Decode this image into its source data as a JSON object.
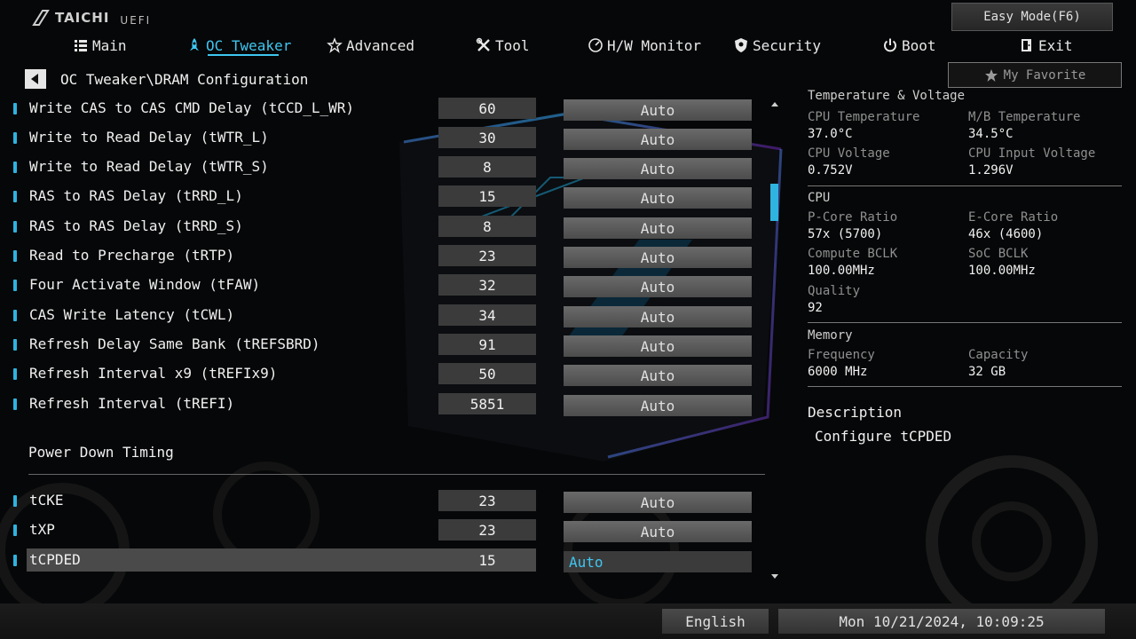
{
  "app": {
    "brand": "TAICHI",
    "subtitle": "UEFI"
  },
  "header": {
    "easy_mode_label": "Easy Mode(F6)"
  },
  "nav": [
    {
      "label": "Main",
      "icon": "list-icon",
      "active": false
    },
    {
      "label": "OC Tweaker",
      "icon": "rocket-icon",
      "active": true
    },
    {
      "label": "Advanced",
      "icon": "star-icon",
      "active": false
    },
    {
      "label": "Tool",
      "icon": "tools-icon",
      "active": false
    },
    {
      "label": "H/W Monitor",
      "icon": "monitor-icon",
      "active": false
    },
    {
      "label": "Security",
      "icon": "shield-icon",
      "active": false
    },
    {
      "label": "Boot",
      "icon": "power-icon",
      "active": false
    },
    {
      "label": "Exit",
      "icon": "exit-icon",
      "active": false
    }
  ],
  "breadcrumb": "OC Tweaker\\DRAM Configuration",
  "favorite_label": "My Favorite",
  "settings": [
    {
      "label": "Write CAS to CAS CMD Delay (tCCD_L_WR)",
      "value": "60",
      "option": "Auto"
    },
    {
      "label": "Write to Read Delay (tWTR_L)",
      "value": "30",
      "option": "Auto"
    },
    {
      "label": "Write to Read Delay (tWTR_S)",
      "value": "8",
      "option": "Auto"
    },
    {
      "label": "RAS to RAS Delay (tRRD_L)",
      "value": "15",
      "option": "Auto"
    },
    {
      "label": "RAS to RAS Delay (tRRD_S)",
      "value": "8",
      "option": "Auto"
    },
    {
      "label": "Read to Precharge (tRTP)",
      "value": "23",
      "option": "Auto"
    },
    {
      "label": "Four Activate Window (tFAW)",
      "value": "32",
      "option": "Auto"
    },
    {
      "label": "CAS Write Latency (tCWL)",
      "value": "34",
      "option": "Auto"
    },
    {
      "label": "Refresh Delay Same Bank (tREFSBRD)",
      "value": "91",
      "option": "Auto"
    },
    {
      "label": "Refresh Interval x9 (tREFIx9)",
      "value": "50",
      "option": "Auto"
    },
    {
      "label": "Refresh Interval (tREFI)",
      "value": "5851",
      "option": "Auto"
    }
  ],
  "section_title": "Power Down Timing",
  "power_down": [
    {
      "label": "tCKE",
      "value": "23",
      "option": "Auto"
    },
    {
      "label": "tXP",
      "value": "23",
      "option": "Auto"
    },
    {
      "label": "tCPDED",
      "value": "15",
      "option": "Auto",
      "selected": true
    }
  ],
  "panel": {
    "temp_voltage": {
      "title": "Temperature & Voltage",
      "cpu_temp_label": "CPU Temperature",
      "cpu_temp": "37.0°C",
      "mb_temp_label": "M/B Temperature",
      "mb_temp": "34.5°C",
      "cpu_voltage_label": "CPU Voltage",
      "cpu_voltage": "0.752V",
      "cpu_input_voltage_label": "CPU Input Voltage",
      "cpu_input_voltage": "1.296V"
    },
    "cpu": {
      "title": "CPU",
      "pcore_label": "P-Core Ratio",
      "pcore": "57x (5700)",
      "ecore_label": "E-Core Ratio",
      "ecore": "46x (4600)",
      "compute_bclk_label": "Compute BCLK",
      "compute_bclk": "100.00MHz",
      "soc_bclk_label": "SoC BCLK",
      "soc_bclk": "100.00MHz",
      "quality_label": "Quality",
      "quality": "92"
    },
    "memory": {
      "title": "Memory",
      "frequency_label": "Frequency",
      "frequency": "6000 MHz",
      "capacity_label": "Capacity",
      "capacity": "32 GB"
    },
    "description_title": "Description",
    "description": "Configure tCPDED"
  },
  "footer": {
    "language": "English",
    "datetime": "Mon 10/21/2024, 10:09:25"
  },
  "colors": {
    "accent": "#3fc6f0",
    "indicator": "#2fb3e0"
  }
}
